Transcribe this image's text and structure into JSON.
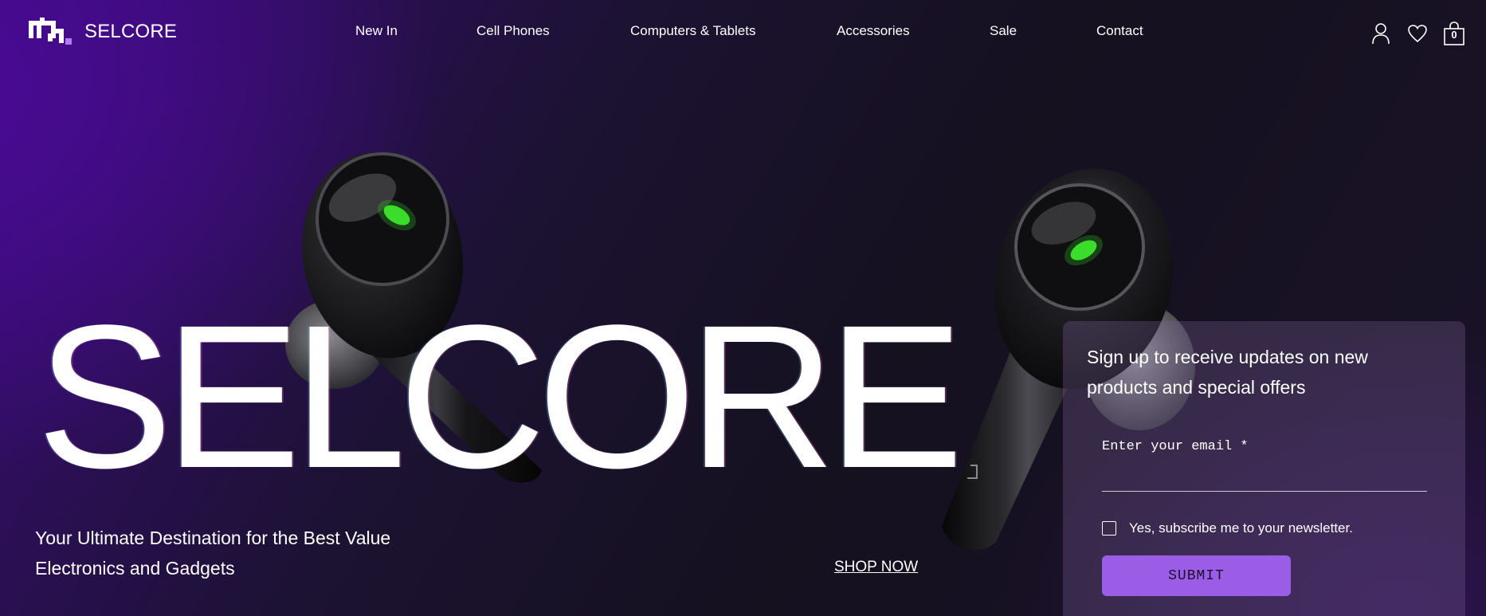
{
  "brand": {
    "name": "SELCORE"
  },
  "nav": {
    "items": [
      {
        "label": "New In"
      },
      {
        "label": "Cell Phones"
      },
      {
        "label": "Computers & Tablets"
      },
      {
        "label": "Accessories"
      },
      {
        "label": "Sale"
      },
      {
        "label": "Contact"
      }
    ]
  },
  "header_icons": {
    "account": "user-icon",
    "wishlist": "heart-icon",
    "cart": "shopping-bag-icon",
    "cart_count": "0"
  },
  "hero": {
    "title": "SELCORE",
    "tagline": "Your Ultimate Destination for the Best Value Electronics and Gadgets",
    "cta_label": "SHOP NOW"
  },
  "signup": {
    "heading": "Sign up to receive updates on new products and special offers",
    "email_label": "Enter your email *",
    "email_value": "",
    "subscribe_label": "Yes, subscribe me to your newsletter.",
    "subscribe_checked": false,
    "submit_label": "SUBMIT"
  },
  "colors": {
    "accent": "#9b5de5",
    "background_dark": "#15111f",
    "background_purple": "#4a0a96",
    "led_green": "#3ddc2a"
  }
}
